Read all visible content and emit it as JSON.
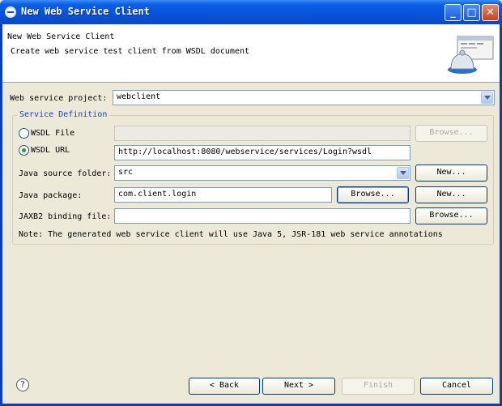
{
  "window": {
    "title": "New Web Service Client"
  },
  "header": {
    "title": "New Web Service Client",
    "description": "Create web service test client from WSDL document"
  },
  "project": {
    "label": "Web service project:",
    "value": "webclient"
  },
  "service_definition": {
    "group_label": "Service Definition",
    "wsdl_file": {
      "label": "WSDL File",
      "value": "",
      "browse_label": "Browse..."
    },
    "wsdl_url": {
      "label": "WSDL URL",
      "value": "http://localhost:8080/webservice/services/Login?wsdl"
    },
    "source_folder": {
      "label": "Java source folder:",
      "value": "src",
      "new_label": "New..."
    },
    "java_package": {
      "label": "Java package:",
      "value": "com.client.login",
      "browse_label": "Browse...",
      "new_label": "New..."
    },
    "jaxb2": {
      "label": "JAXB2 binding file:",
      "value": "",
      "browse_label": "Browse..."
    },
    "note": "Note: The generated web service client will use Java 5, JSR-181 web service annotations"
  },
  "footer": {
    "back_label": "< Back",
    "next_label": "Next >",
    "finish_label": "Finish",
    "cancel_label": "Cancel",
    "help_glyph": "?"
  },
  "icons": {
    "title": "eclipse-icon",
    "help": "help-icon",
    "wizard": "wizard-banner-icon"
  },
  "colors": {
    "titlebar": "#0753d8",
    "window_bg": "#ece9d8",
    "group_title": "#0046d5"
  }
}
